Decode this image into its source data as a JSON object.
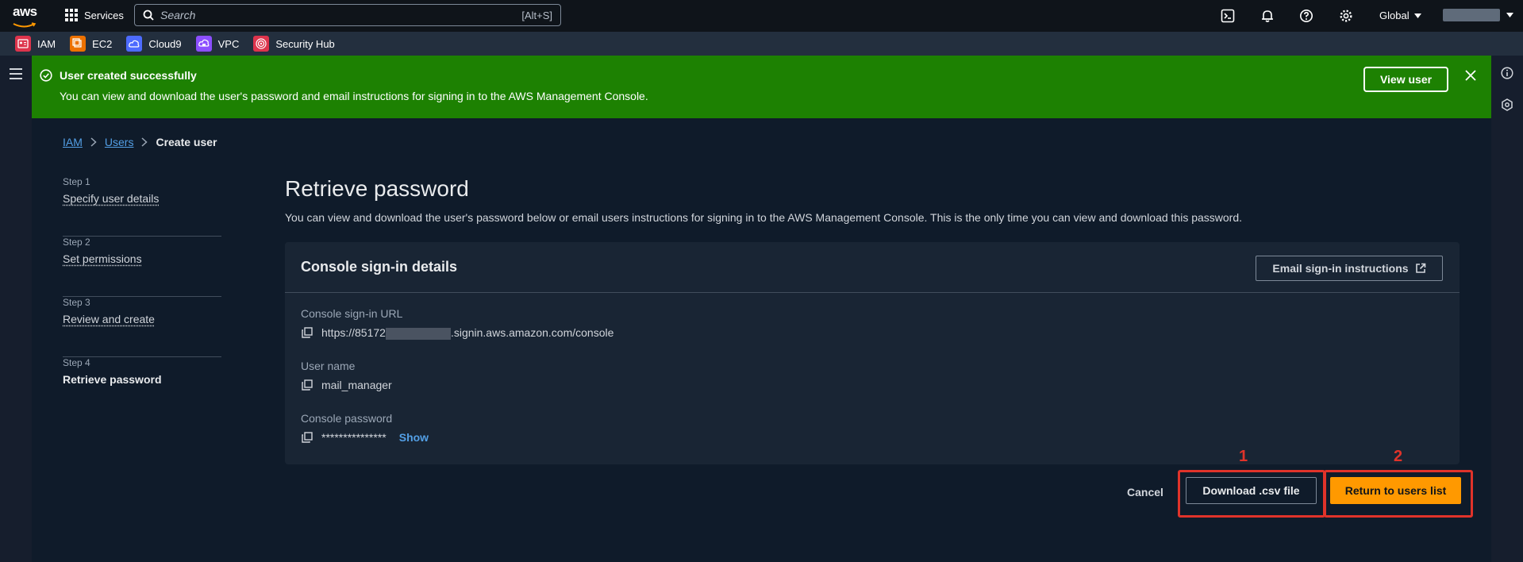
{
  "topnav": {
    "logo_text": "aws",
    "services_label": "Services",
    "search_placeholder": "Search",
    "search_shortcut": "[Alt+S]",
    "region_label": "Global"
  },
  "favorites": [
    {
      "label": "IAM",
      "color": "#dd344c"
    },
    {
      "label": "EC2",
      "color": "#ed7100"
    },
    {
      "label": "Cloud9",
      "color": "#4d6bfe"
    },
    {
      "label": "VPC",
      "color": "#8c4fff"
    },
    {
      "label": "Security Hub",
      "color": "#dd344c"
    }
  ],
  "flash": {
    "title": "User created successfully",
    "message": "You can view and download the user's password and email instructions for signing in to the AWS Management Console.",
    "view_button": "View user"
  },
  "breadcrumb": {
    "items": [
      "IAM",
      "Users"
    ],
    "current": "Create user"
  },
  "steps": [
    {
      "num": "Step 1",
      "label": "Specify user details"
    },
    {
      "num": "Step 2",
      "label": "Set permissions"
    },
    {
      "num": "Step 3",
      "label": "Review and create"
    },
    {
      "num": "Step 4",
      "label": "Retrieve password"
    }
  ],
  "page": {
    "title": "Retrieve password",
    "description": "You can view and download the user's password below or email users instructions for signing in to the AWS Management Console. This is the only time you can view and download this password."
  },
  "panel": {
    "title": "Console sign-in details",
    "email_button": "Email sign-in instructions",
    "fields": {
      "url_label": "Console sign-in URL",
      "url_prefix": "https://85172",
      "url_suffix": ".signin.aws.amazon.com/console",
      "username_label": "User name",
      "username_value": "mail_manager",
      "password_label": "Console password",
      "password_value": "***************",
      "show_label": "Show"
    }
  },
  "actions": {
    "cancel": "Cancel",
    "download": "Download .csv file",
    "return": "Return to users list"
  },
  "annotations": [
    "1",
    "2"
  ]
}
